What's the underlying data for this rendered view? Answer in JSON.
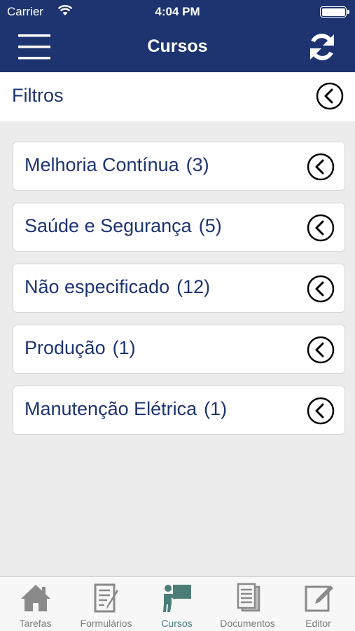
{
  "status_bar": {
    "carrier": "Carrier",
    "time": "4:04 PM",
    "icons": [
      "wifi-icon",
      "battery-icon"
    ]
  },
  "nav": {
    "title": "Cursos",
    "left_icon": "hamburger-menu-icon",
    "right_icon": "refresh-icon"
  },
  "filters": {
    "label": "Filtros",
    "icon": "chevron-left-circle-icon"
  },
  "courses": [
    {
      "name": "Melhoria Contínua",
      "count": "(3)"
    },
    {
      "name": "Saúde e Segurança",
      "count": "(5)"
    },
    {
      "name": "Não especificado",
      "count": "(12)"
    },
    {
      "name": "Produção",
      "count": "(1)"
    },
    {
      "name": "Manutenção Elétrica",
      "count": "(1)"
    }
  ],
  "tabs": [
    {
      "label": "Tarefas",
      "icon": "home-icon",
      "active": false
    },
    {
      "label": "Formulários",
      "icon": "form-icon",
      "active": false
    },
    {
      "label": "Cursos",
      "icon": "presenter-icon",
      "active": true
    },
    {
      "label": "Documentos",
      "icon": "documents-icon",
      "active": false
    },
    {
      "label": "Editor",
      "icon": "edit-icon",
      "active": false
    }
  ],
  "colors": {
    "nav_background": "#1d3470",
    "text_primary": "#1d3470",
    "background": "#ececec",
    "tab_active": "#4c7e78",
    "tab_inactive": "#7d7d7d"
  }
}
